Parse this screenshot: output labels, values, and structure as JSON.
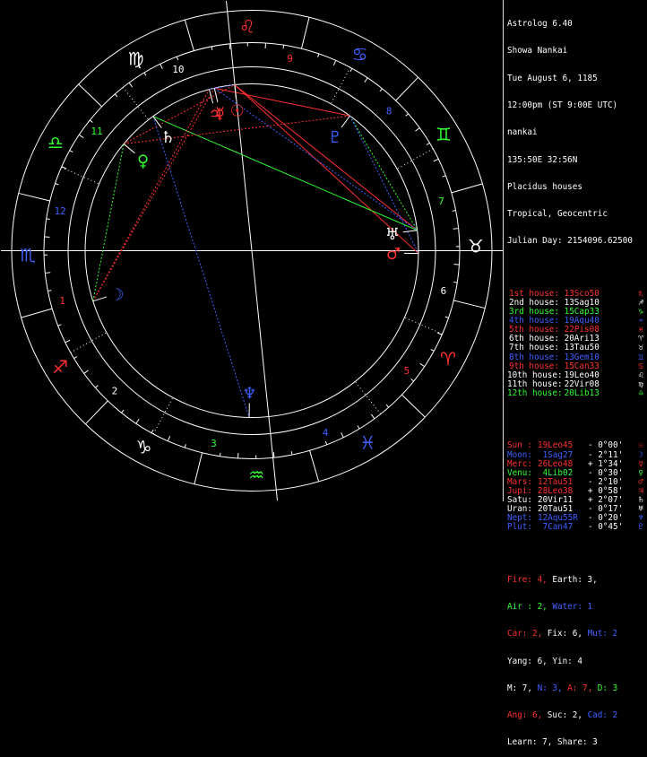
{
  "header": {
    "app_title": "Astrolog 6.40",
    "chart_name": "Showa Nankai",
    "date": "Tue August 6, 1185",
    "time": "12:00pm (ST 9:00E UTC)",
    "place": "nankai",
    "coords": "135:50E 32:56N",
    "house_system": "Placidus houses",
    "zodiac": "Tropical, Geocentric",
    "julian_day": "Julian Day: 2154096.62500"
  },
  "houses": [
    {
      "label": "1st house:",
      "value": "13Sco50",
      "sym": "♏",
      "color": "#ff3030"
    },
    {
      "label": "2nd house:",
      "value": "13Sag10",
      "sym": "♐",
      "color": "#ffffff"
    },
    {
      "label": "3rd house:",
      "value": "15Cap33",
      "sym": "♑",
      "color": "#30ff30"
    },
    {
      "label": "4th house:",
      "value": "19Aqu40",
      "sym": "♒",
      "color": "#4060ff"
    },
    {
      "label": "5th house:",
      "value": "22Pis08",
      "sym": "♓",
      "color": "#ff3030"
    },
    {
      "label": "6th house:",
      "value": "20Ari13",
      "sym": "♈",
      "color": "#ffffff"
    },
    {
      "label": "7th house:",
      "value": "13Tau50",
      "sym": "♉",
      "color": "#ffffff"
    },
    {
      "label": "8th house:",
      "value": "13Gem10",
      "sym": "♊",
      "color": "#4060ff"
    },
    {
      "label": "9th house:",
      "value": "15Can33",
      "sym": "♋",
      "color": "#ff3030"
    },
    {
      "label": "10th house:",
      "value": "19Leo40",
      "sym": "♌",
      "color": "#ffffff"
    },
    {
      "label": "11th house:",
      "value": "22Vir08",
      "sym": "♍",
      "color": "#ffffff"
    },
    {
      "label": "12th house:",
      "value": "20Lib13",
      "sym": "♎",
      "color": "#30ff30"
    }
  ],
  "planets": [
    {
      "label": "Sun :",
      "pos": "19Leo45",
      "lat": "- 0°00'",
      "sym": "☉",
      "color": "#ff3030"
    },
    {
      "label": "Moon:",
      "pos": " 1Sag27",
      "lat": "- 2°11'",
      "sym": "☽",
      "color": "#4060ff"
    },
    {
      "label": "Merc:",
      "pos": "26Leo48",
      "lat": "+ 1°34'",
      "sym": "☿",
      "color": "#ff3030"
    },
    {
      "label": "Venu:",
      "pos": " 4Lib02",
      "lat": "- 0°30'",
      "sym": "♀",
      "color": "#30ff30"
    },
    {
      "label": "Mars:",
      "pos": "12Tau51",
      "lat": "- 2°10'",
      "sym": "♂",
      "color": "#ff3030"
    },
    {
      "label": "Jupi:",
      "pos": "28Leo38",
      "lat": "+ 0°58'",
      "sym": "♃",
      "color": "#ff3030"
    },
    {
      "label": "Satu:",
      "pos": "20Vir11",
      "lat": "+ 2°07'",
      "sym": "♄",
      "color": "#ffffff"
    },
    {
      "label": "Uran:",
      "pos": "20Tau51",
      "lat": "- 0°17'",
      "sym": "♅",
      "color": "#ffffff"
    },
    {
      "label": "Nept:",
      "pos": "12Aqu55R",
      "lat": "- 0°20'",
      "sym": "♆",
      "color": "#4060ff"
    },
    {
      "label": "Plut:",
      "pos": " 7Can47",
      "lat": "- 0°45'",
      "sym": "♇",
      "color": "#4060ff"
    }
  ],
  "summary": {
    "elements": {
      "fire": "Fire: 4,",
      "earth": " Earth: 3,",
      "air": "Air : 2,",
      "water": " Water: 1"
    },
    "modes": {
      "car": "Car: 2,",
      "fix": " Fix: 6,",
      "mut": " Mut: 2"
    },
    "yang": "Yang: 6, Yin: 4",
    "quads": {
      "m": "M: 7,",
      "n": " N: 3,",
      "a": " A: 7,",
      "d": " D: 3"
    },
    "angs": {
      "ang": "Ang: 6,",
      "suc": " Suc: 2,",
      "cad": " Cad: 2"
    },
    "learn": "Learn: 7, Share: 3"
  },
  "wheel": {
    "zodiac_signs": [
      {
        "sym": "♈",
        "lon": 15,
        "color": "#ff3030"
      },
      {
        "sym": "♉",
        "lon": 45,
        "color": "#ffffff"
      },
      {
        "sym": "♊",
        "lon": 75,
        "color": "#30ff30"
      },
      {
        "sym": "♋",
        "lon": 105,
        "color": "#4060ff"
      },
      {
        "sym": "♌",
        "lon": 135,
        "color": "#ff3030"
      },
      {
        "sym": "♍",
        "lon": 165,
        "color": "#ffffff"
      },
      {
        "sym": "♎",
        "lon": 195,
        "color": "#30ff30"
      },
      {
        "sym": "♏",
        "lon": 225,
        "color": "#4060ff"
      },
      {
        "sym": "♐",
        "lon": 255,
        "color": "#ff3030"
      },
      {
        "sym": "♑",
        "lon": 285,
        "color": "#ffffff"
      },
      {
        "sym": "♒",
        "lon": 315,
        "color": "#30ff30"
      },
      {
        "sym": "♓",
        "lon": 345,
        "color": "#4060ff"
      }
    ],
    "house_cusps": [
      223.83,
      253.17,
      285.55,
      319.67,
      352.13,
      20.22,
      43.83,
      73.17,
      105.55,
      139.67,
      172.13,
      200.22
    ],
    "house_numbers": [
      {
        "n": "1",
        "color": "#ff3030"
      },
      {
        "n": "2",
        "color": "#ffffff"
      },
      {
        "n": "3",
        "color": "#30ff30"
      },
      {
        "n": "4",
        "color": "#4060ff"
      },
      {
        "n": "5",
        "color": "#ff3030"
      },
      {
        "n": "6",
        "color": "#ffffff"
      },
      {
        "n": "7",
        "color": "#30ff30"
      },
      {
        "n": "8",
        "color": "#4060ff"
      },
      {
        "n": "9",
        "color": "#ff3030"
      },
      {
        "n": "10",
        "color": "#ffffff"
      },
      {
        "n": "11",
        "color": "#30ff30"
      },
      {
        "n": "12",
        "color": "#4060ff"
      }
    ],
    "planets": [
      {
        "sym": "☉",
        "lon": 139.75,
        "color": "#ff3030"
      },
      {
        "sym": "☽",
        "lon": 241.45,
        "color": "#4060ff"
      },
      {
        "sym": "☿",
        "lon": 146.8,
        "color": "#ff3030"
      },
      {
        "sym": "♀",
        "lon": 184.03,
        "color": "#30ff30"
      },
      {
        "sym": "♂",
        "lon": 42.85,
        "color": "#ff3030"
      },
      {
        "sym": "♃",
        "lon": 148.63,
        "color": "#ff3030"
      },
      {
        "sym": "♄",
        "lon": 170.18,
        "color": "#ffffff"
      },
      {
        "sym": "♅",
        "lon": 50.85,
        "color": "#ffffff"
      },
      {
        "sym": "♆",
        "lon": 312.92,
        "color": "#4060ff"
      },
      {
        "sym": "♇",
        "lon": 97.78,
        "color": "#4060ff"
      }
    ],
    "aspects": [
      {
        "a": 2,
        "b": 9,
        "color": "#ff3030"
      },
      {
        "a": 0,
        "b": 4,
        "color": "#ff3030"
      },
      {
        "a": 0,
        "b": 7,
        "color": "#ff3030"
      },
      {
        "a": 6,
        "b": 7,
        "color": "#30ff30"
      },
      {
        "a": 1,
        "b": 5,
        "color": "#ff3030",
        "dash": true
      },
      {
        "a": 1,
        "b": 2,
        "color": "#ff3030",
        "dash": true
      },
      {
        "a": 3,
        "b": 9,
        "color": "#ff3030",
        "dash": true
      },
      {
        "a": 3,
        "b": 0,
        "color": "#ff3030",
        "dash": true
      },
      {
        "a": 1,
        "b": 3,
        "color": "#30ff30",
        "dash": true
      },
      {
        "a": 9,
        "b": 7,
        "color": "#30ff30",
        "dash": true
      },
      {
        "a": 9,
        "b": 4,
        "color": "#4060ff",
        "dash": true
      },
      {
        "a": 6,
        "b": 8,
        "color": "#4060ff",
        "dash": true
      },
      {
        "a": 5,
        "b": 0,
        "color": "#4060ff",
        "dash": true
      },
      {
        "a": 2,
        "b": 7,
        "color": "#4060ff",
        "dash": true
      }
    ]
  }
}
